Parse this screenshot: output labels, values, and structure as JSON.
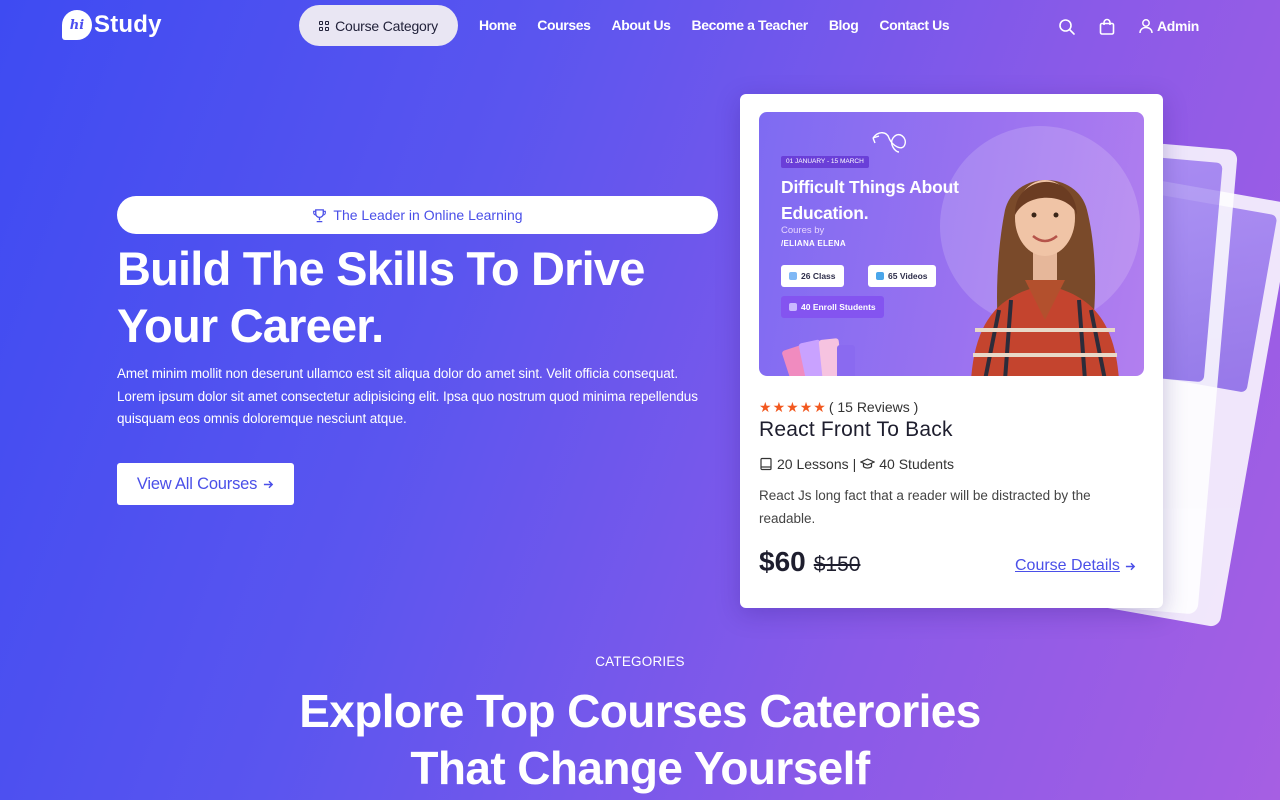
{
  "header": {
    "logo_mark": "hi",
    "logo_text": "Study",
    "category_button": "Course Category",
    "nav": [
      "Home",
      "Courses",
      "About Us",
      "Become a Teacher",
      "Blog",
      "Contact Us"
    ],
    "user_label": "Admin",
    "icons": [
      "search-icon",
      "shopping-bag-icon",
      "user-icon"
    ]
  },
  "hero": {
    "badge": "The Leader in Online Learning",
    "title_line1": "Build The Skills To Drive",
    "title_line2": "Your Career.",
    "description": "Amet minim mollit non deserunt ullamco est sit aliqua dolor do amet sint. Velit officia consequat. Lorem ipsum dolor sit amet consectetur adipisicing elit. Ipsa quo nostrum quod minima repellendus quisquam eos omnis doloremque nesciunt atque.",
    "cta": "View All Courses"
  },
  "course_card": {
    "thumbnail": {
      "date": "01 JANUARY - 15 MARCH",
      "title": "Difficult Things About Education.",
      "by": "Coures by",
      "author": "/ELIANA ELENA",
      "chips": [
        "26 Class",
        "65 Videos",
        "40 Enroll Students"
      ]
    },
    "stars": 5,
    "reviews": "( 15 Reviews )",
    "title": "React Front To Back",
    "lessons": "20 Lessons",
    "separator": "|",
    "students": "40 Students",
    "description": "React Js long fact that a reader will be distracted by the readable.",
    "price": "$60",
    "old_price": "$150",
    "details_link": "Course Details"
  },
  "categories": {
    "label": "CATEGORIES",
    "title_line1": "Explore Top Courses Caterories",
    "title_line2": "That Change Yourself"
  },
  "colors": {
    "accent": "#4a4fe8",
    "star": "#f2581f",
    "bg_start": "#3e4bf2",
    "bg_end": "#a65fe3"
  }
}
